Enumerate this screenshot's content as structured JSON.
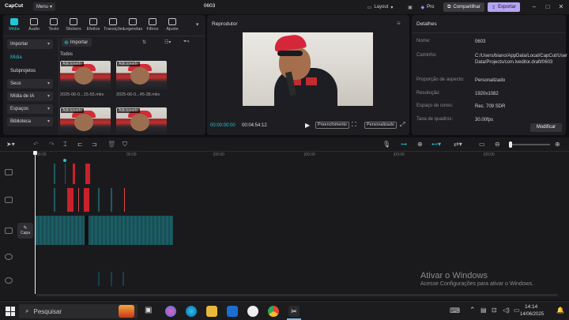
{
  "app": {
    "logo": "CapCut",
    "menu_label": "Menu",
    "project_title": "0603",
    "layout_label": "Layout",
    "pro_label": "Pro",
    "share_label": "Compartilhar",
    "export_label": "Exportar"
  },
  "media_toolbar": [
    {
      "label": "Mídia",
      "icon": "media-icon",
      "active": true
    },
    {
      "label": "Áudio",
      "icon": "audio-icon"
    },
    {
      "label": "Texto",
      "icon": "text-icon"
    },
    {
      "label": "Stickers",
      "icon": "stickers-icon"
    },
    {
      "label": "Efeitos",
      "icon": "effects-icon"
    },
    {
      "label": "Transições",
      "icon": "transitions-icon"
    },
    {
      "label": "Legendas",
      "icon": "captions-icon"
    },
    {
      "label": "Filtros",
      "icon": "filters-icon"
    },
    {
      "label": "Ajuste",
      "icon": "adjust-icon"
    }
  ],
  "sidebar": {
    "items": [
      {
        "label": "Importar",
        "type": "button"
      },
      {
        "label": "Mídia",
        "type": "active"
      },
      {
        "label": "Subprojetos",
        "type": "text"
      },
      {
        "label": "Seus",
        "type": "button"
      },
      {
        "label": "Mídia de IA",
        "type": "button"
      },
      {
        "label": "Espaços",
        "type": "button"
      },
      {
        "label": "Biblioteca",
        "type": "button"
      }
    ]
  },
  "media": {
    "import_button": "Importar",
    "all_label": "Todos",
    "thumbs": [
      {
        "badge": "Adicionado",
        "caption": "2025-06-0...15-55.mkv"
      },
      {
        "badge": "Adicionado",
        "caption": "2025-06-0...45-38.mkv"
      },
      {
        "badge": "Adicionado",
        "caption": ""
      },
      {
        "badge": "Adicionado",
        "caption": ""
      }
    ]
  },
  "player": {
    "title": "Reprodutor",
    "current_time": "00:00:00:00",
    "total_time": "00:04:54:12",
    "fill_label": "Preenchimento",
    "ratio_label": "Personalizado"
  },
  "details": {
    "title": "Detalhes",
    "rows": [
      {
        "label": "Nome:",
        "value": "0603"
      },
      {
        "label": "Caminho:",
        "value": "C:/Users/biano/AppData/Local/CapCut/User Data/Projects/com.lveditor.draft/0603"
      },
      {
        "label": "Proporção de aspecto:",
        "value": "Personalizado"
      },
      {
        "label": "Resolução:",
        "value": "1920x1082"
      },
      {
        "label": "Espaço de cores:",
        "value": "Rec. 709 SDR"
      },
      {
        "label": "Taxa de quadros:",
        "value": "30.00fps"
      }
    ],
    "modify_button": "Modificar"
  },
  "timeline": {
    "ruler": [
      "00:00",
      "00:00",
      "|00:00",
      "|00:00",
      "|00:00",
      "|00:00"
    ],
    "cover_label": "Capa"
  },
  "watermark": {
    "line1": "Ativar o Windows",
    "line2": "Acesse Configurações para ativar o Windows."
  },
  "taskbar": {
    "search_placeholder": "Pesquisar",
    "time": "14:14",
    "date": "14/06/2025"
  },
  "colors": {
    "accent": "#20c5d6",
    "clip_red": "#c8222a",
    "clip_teal": "#1d5c63",
    "export": "#b5a4f5"
  }
}
